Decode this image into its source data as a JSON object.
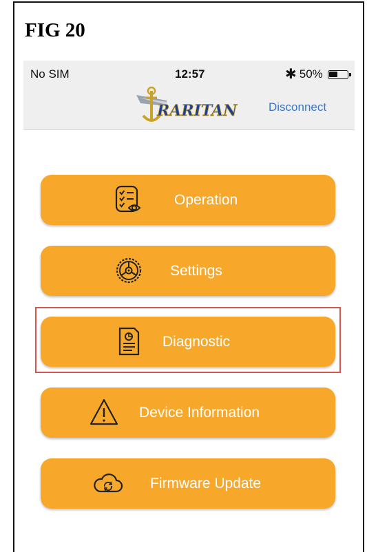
{
  "figure_label": "FIG 20",
  "status_bar": {
    "carrier": "No SIM",
    "time": "12:57",
    "battery_percent": "50%",
    "battery_level": 0.5
  },
  "header": {
    "logo_text": "RARITAN",
    "disconnect_label": "Disconnect"
  },
  "menu": {
    "operation": "Operation",
    "settings": "Settings",
    "diagnostic": "Diagnostic",
    "device_information": "Device Information",
    "firmware_update": "Firmware Update"
  },
  "colors": {
    "button": "#f7a82a",
    "link": "#3b77c4",
    "highlight": "#d9534f",
    "logo_blue": "#1f3f93",
    "logo_gold": "#c9a227"
  },
  "highlighted_item": "diagnostic"
}
